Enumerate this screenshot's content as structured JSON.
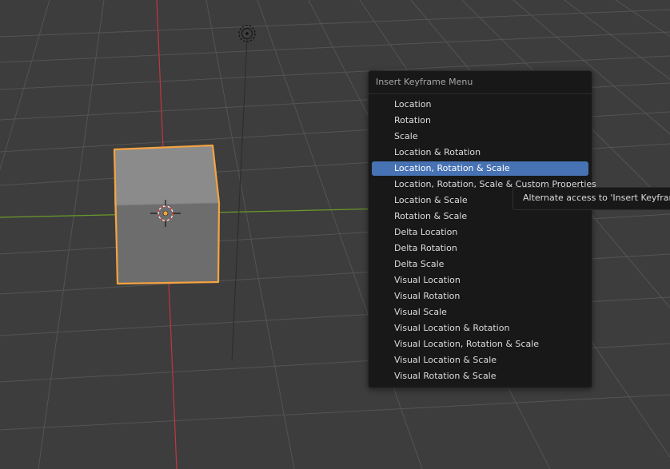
{
  "menu": {
    "title": "Insert Keyframe Menu",
    "items": [
      {
        "label": "Location"
      },
      {
        "label": "Rotation"
      },
      {
        "label": "Scale"
      },
      {
        "label": "Location & Rotation"
      },
      {
        "label": "Location, Rotation & Scale"
      },
      {
        "label": "Location, Rotation, Scale & Custom Properties"
      },
      {
        "label": "Location & Scale"
      },
      {
        "label": "Rotation & Scale"
      },
      {
        "label": "Delta Location"
      },
      {
        "label": "Delta Rotation"
      },
      {
        "label": "Delta Scale"
      },
      {
        "label": "Visual Location"
      },
      {
        "label": "Visual Rotation"
      },
      {
        "label": "Visual Scale"
      },
      {
        "label": "Visual Location & Rotation"
      },
      {
        "label": "Visual Location, Rotation & Scale"
      },
      {
        "label": "Visual Location & Scale"
      },
      {
        "label": "Visual Rotation & Scale"
      }
    ],
    "highlight_color": "#4772b3"
  },
  "tooltip": {
    "text": "Alternate access to 'Insert Keyframe'"
  },
  "viewport": {
    "background_color": "#3d3d3d",
    "selection_outline_color": "#f5a340",
    "x_axis_color": "#c2363f",
    "y_axis_color": "#6a9a2a"
  }
}
